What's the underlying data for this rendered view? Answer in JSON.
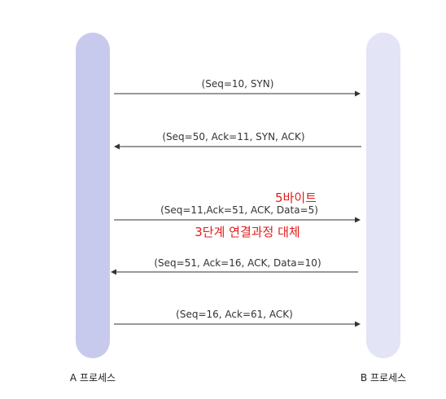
{
  "processes": {
    "left": {
      "label": "A 프로세스",
      "color": "#c8caed"
    },
    "right": {
      "label": "B 프로세스",
      "color": "#e3e4f6"
    }
  },
  "messages": [
    {
      "text": "(Seq=10, SYN)",
      "direction": "A→B"
    },
    {
      "text": "(Seq=50, Ack=11, SYN, ACK)",
      "direction": "B→A"
    },
    {
      "text": "(Seq=11,Ack=51, ACK, Data=5)",
      "direction": "A→B"
    },
    {
      "text": "(Seq=51, Ack=16, ACK, Data=10)",
      "direction": "B→A"
    },
    {
      "text": "(Seq=16, Ack=61, ACK)",
      "direction": "A→B"
    }
  ],
  "annotations": {
    "bytes": "5바이트",
    "replace": "3단계 연결과정 대체",
    "color": "#e11d1d"
  },
  "arrow_color": "#333333"
}
